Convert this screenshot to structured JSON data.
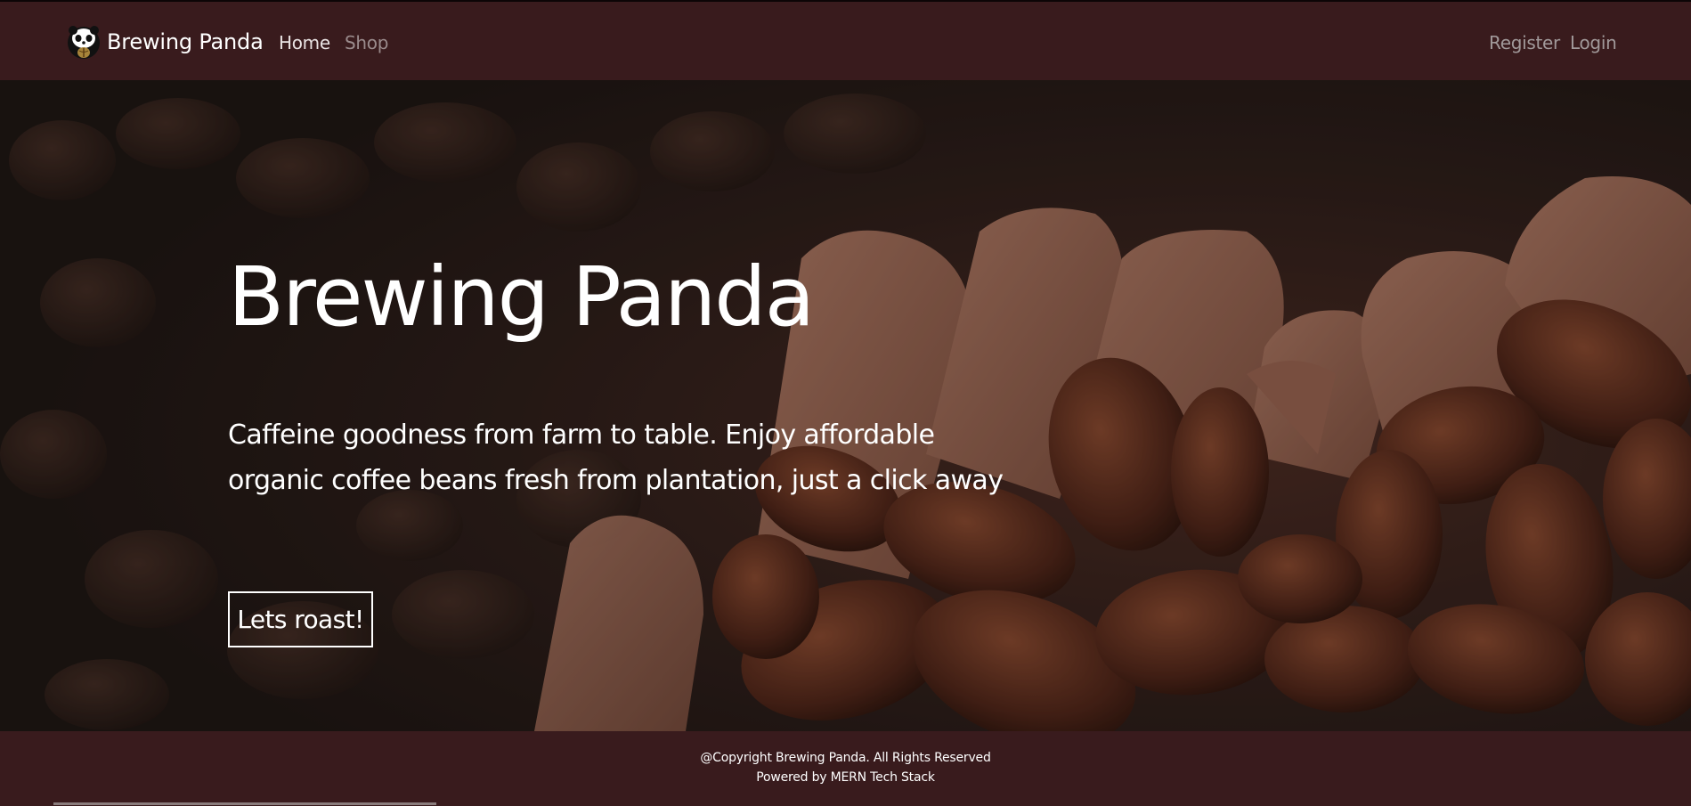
{
  "navbar": {
    "brand_name": "Brewing Panda",
    "logo_icon": "panda-logo-icon",
    "links": {
      "home": "Home",
      "shop": "Shop",
      "register": "Register",
      "login": "Login"
    }
  },
  "hero": {
    "title": "Brewing Panda",
    "description": "Caffeine goodness from farm to table. Enjoy affordable organic coffee beans fresh from plantation, just a click away",
    "cta_label": "Lets roast!"
  },
  "footer": {
    "copyright": "@Copyright Brewing Panda. All Rights Reserved",
    "powered_by": "Powered by MERN Tech Stack"
  },
  "colors": {
    "navbar_bg": "#391b1d",
    "hero_bg": "#1f1716",
    "text": "#ffffff",
    "muted_link": "#9a8b8c"
  }
}
